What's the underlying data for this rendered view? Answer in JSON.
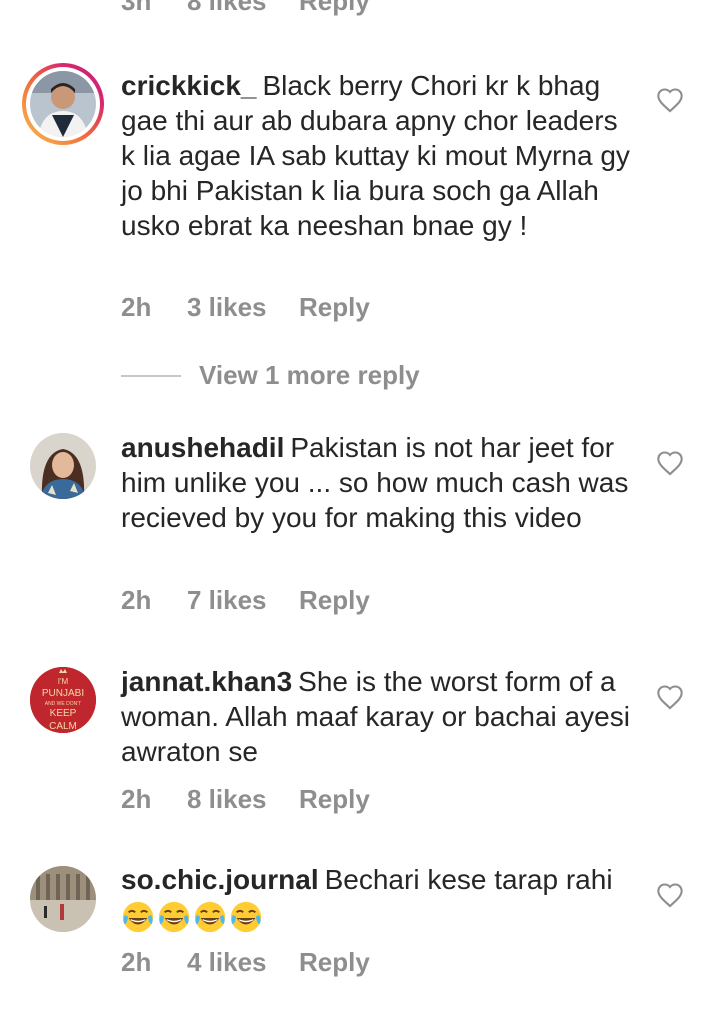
{
  "top_partial": {
    "time": "3h",
    "likes": "8 likes",
    "reply": "Reply"
  },
  "comments": [
    {
      "username": "crickkick_",
      "text": "Black berry Chori kr k bhag gae thi aur ab dubara apny chor leaders k lia agae IA sab kuttay ki mout Myrna gy jo bhi Pakistan k lia bura soch ga Allah usko ebrat ka neeshan bnae gy !",
      "time": "2h",
      "likes": "3 likes",
      "reply": "Reply",
      "has_story_ring": true
    },
    {
      "username": "anushehadil",
      "text": "Pakistan is not har jeet for him unlike you ... so how much cash was recieved by you for making this video",
      "time": "2h",
      "likes": "7 likes",
      "reply": "Reply"
    },
    {
      "username": "jannat.khan3",
      "text": "She is the worst form of a woman. Allah maaf karay or bachai ayesi awraton se",
      "time": "2h",
      "likes": "8 likes",
      "reply": "Reply",
      "avatar_text": [
        "I'M",
        "PUNJABI",
        "AND WE DON'T",
        "KEEP",
        "CALM"
      ]
    },
    {
      "username": "so.chic.journal",
      "text": "Bechari kese tarap rahi",
      "emojis": [
        "face-with-tears-of-joy",
        "face-with-tears-of-joy",
        "face-with-tears-of-joy",
        "face-with-tears-of-joy"
      ],
      "time": "2h",
      "likes": "4 likes",
      "reply": "Reply"
    }
  ],
  "view_more_replies": "View 1 more reply",
  "colors": {
    "text": "#262626",
    "meta": "#8e8e8e",
    "heart_outline": "#8e8e8e",
    "punjabi_avatar_bg": "#c0262d"
  }
}
